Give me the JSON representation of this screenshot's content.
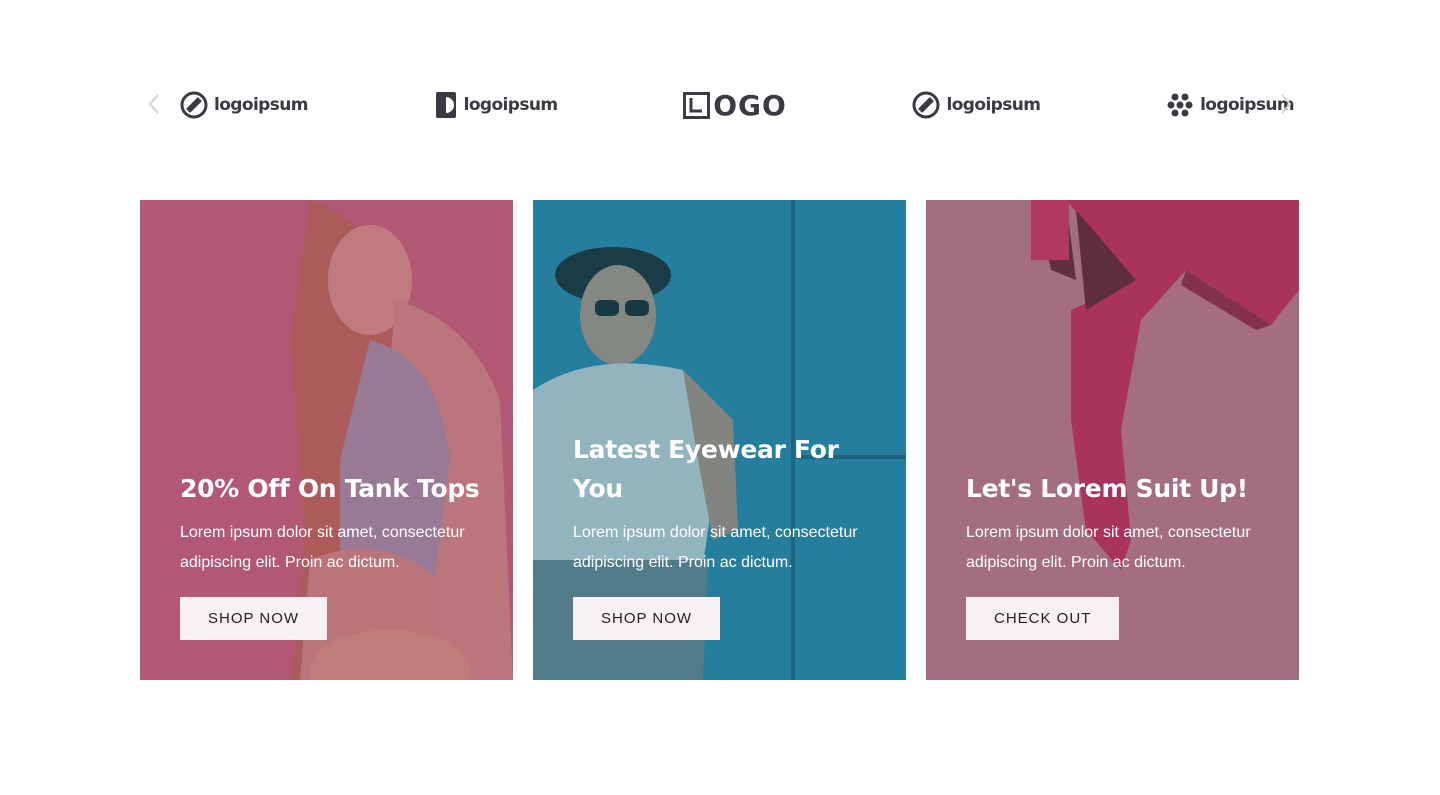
{
  "carousel": {
    "prev_icon": "chevron-left-icon",
    "next_icon": "chevron-right-icon",
    "logos": [
      {
        "text": "logoipsum",
        "icon": "logoipsum-circle-icon"
      },
      {
        "text": "logoipsum",
        "icon": "logoipsum-half-icon"
      },
      {
        "text": "OGO",
        "icon": "logo-square-l-icon"
      },
      {
        "text": "logoipsum",
        "icon": "logoipsum-circle-icon"
      },
      {
        "text": "logoipsum",
        "icon": "logoipsum-flower-icon"
      }
    ]
  },
  "cards": [
    {
      "title": "20% Off On Tank Tops",
      "body": "Lorem ipsum dolor sit amet, consectetur adipiscing elit. Proin ac dictum.",
      "button": "SHOP NOW",
      "tint": "#a24f6c"
    },
    {
      "title": "Latest Eyewear For You",
      "body": "Lorem ipsum dolor sit amet, consectetur adipiscing elit. Proin ac dictum.",
      "button": "SHOP NOW",
      "tint": "#1f6a83"
    },
    {
      "title": "Let's Lorem Suit Up!",
      "body": "Lorem ipsum dolor sit amet, consectetur adipiscing elit. Proin ac dictum.",
      "button": "CHECK OUT",
      "tint": "#9a6778"
    }
  ]
}
